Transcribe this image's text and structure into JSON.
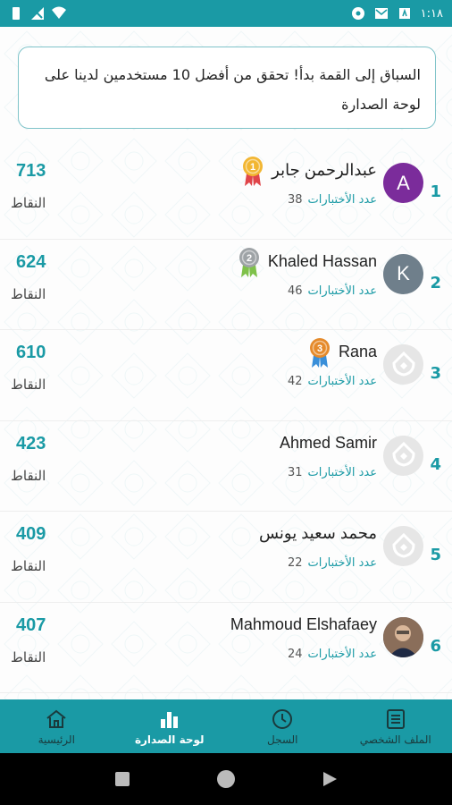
{
  "status_bar": {
    "time": "١:١٨"
  },
  "banner": {
    "text": "السباق إلى القمة بدأ! تحقق من أفضل 10 مستخدمين لدينا على لوحة الصدارة"
  },
  "leaderboard": [
    {
      "rank": "1",
      "name": "عبدالرحمن جابر",
      "avatar_letter": "A",
      "avatar_style": "purple",
      "medal": "1",
      "medal_color": "#f2b632",
      "tests_label": "عدد الأختبارات",
      "tests": "38",
      "points": "713",
      "points_label": "النقاط"
    },
    {
      "rank": "2",
      "name": "Khaled Hassan",
      "avatar_letter": "K",
      "avatar_style": "gray",
      "medal": "2",
      "medal_color": "#9ea3a6",
      "tests_label": "عدد الأختبارات",
      "tests": "46",
      "points": "624",
      "points_label": "النقاط"
    },
    {
      "rank": "3",
      "name": "Rana",
      "avatar_letter": "",
      "avatar_style": "placeholder",
      "medal": "3",
      "medal_color": "#e58a2b",
      "tests_label": "عدد الأختبارات",
      "tests": "42",
      "points": "610",
      "points_label": "النقاط"
    },
    {
      "rank": "4",
      "name": "Ahmed Samir",
      "avatar_letter": "",
      "avatar_style": "placeholder",
      "medal": "",
      "medal_color": "",
      "tests_label": "عدد الأختبارات",
      "tests": "31",
      "points": "423",
      "points_label": "النقاط"
    },
    {
      "rank": "5",
      "name": "محمد سعيد يونس",
      "avatar_letter": "",
      "avatar_style": "placeholder",
      "medal": "",
      "medal_color": "",
      "tests_label": "عدد الأختبارات",
      "tests": "22",
      "points": "409",
      "points_label": "النقاط"
    },
    {
      "rank": "6",
      "name": "Mahmoud Elshafaey",
      "avatar_letter": "",
      "avatar_style": "photo",
      "medal": "",
      "medal_color": "",
      "tests_label": "عدد الأختبارات",
      "tests": "24",
      "points": "407",
      "points_label": "النقاط"
    }
  ],
  "bottom_nav": {
    "items": [
      {
        "label": "الملف الشخصي",
        "icon": "profile-list-icon",
        "active": false
      },
      {
        "label": "السجل",
        "icon": "history-icon",
        "active": false
      },
      {
        "label": "لوحة الصدارة",
        "icon": "leaderboard-icon",
        "active": true
      },
      {
        "label": "الرئيسية",
        "icon": "home-icon",
        "active": false
      }
    ]
  },
  "colors": {
    "primary": "#1a9aa5",
    "nav_inactive": "#1a3a3c"
  }
}
